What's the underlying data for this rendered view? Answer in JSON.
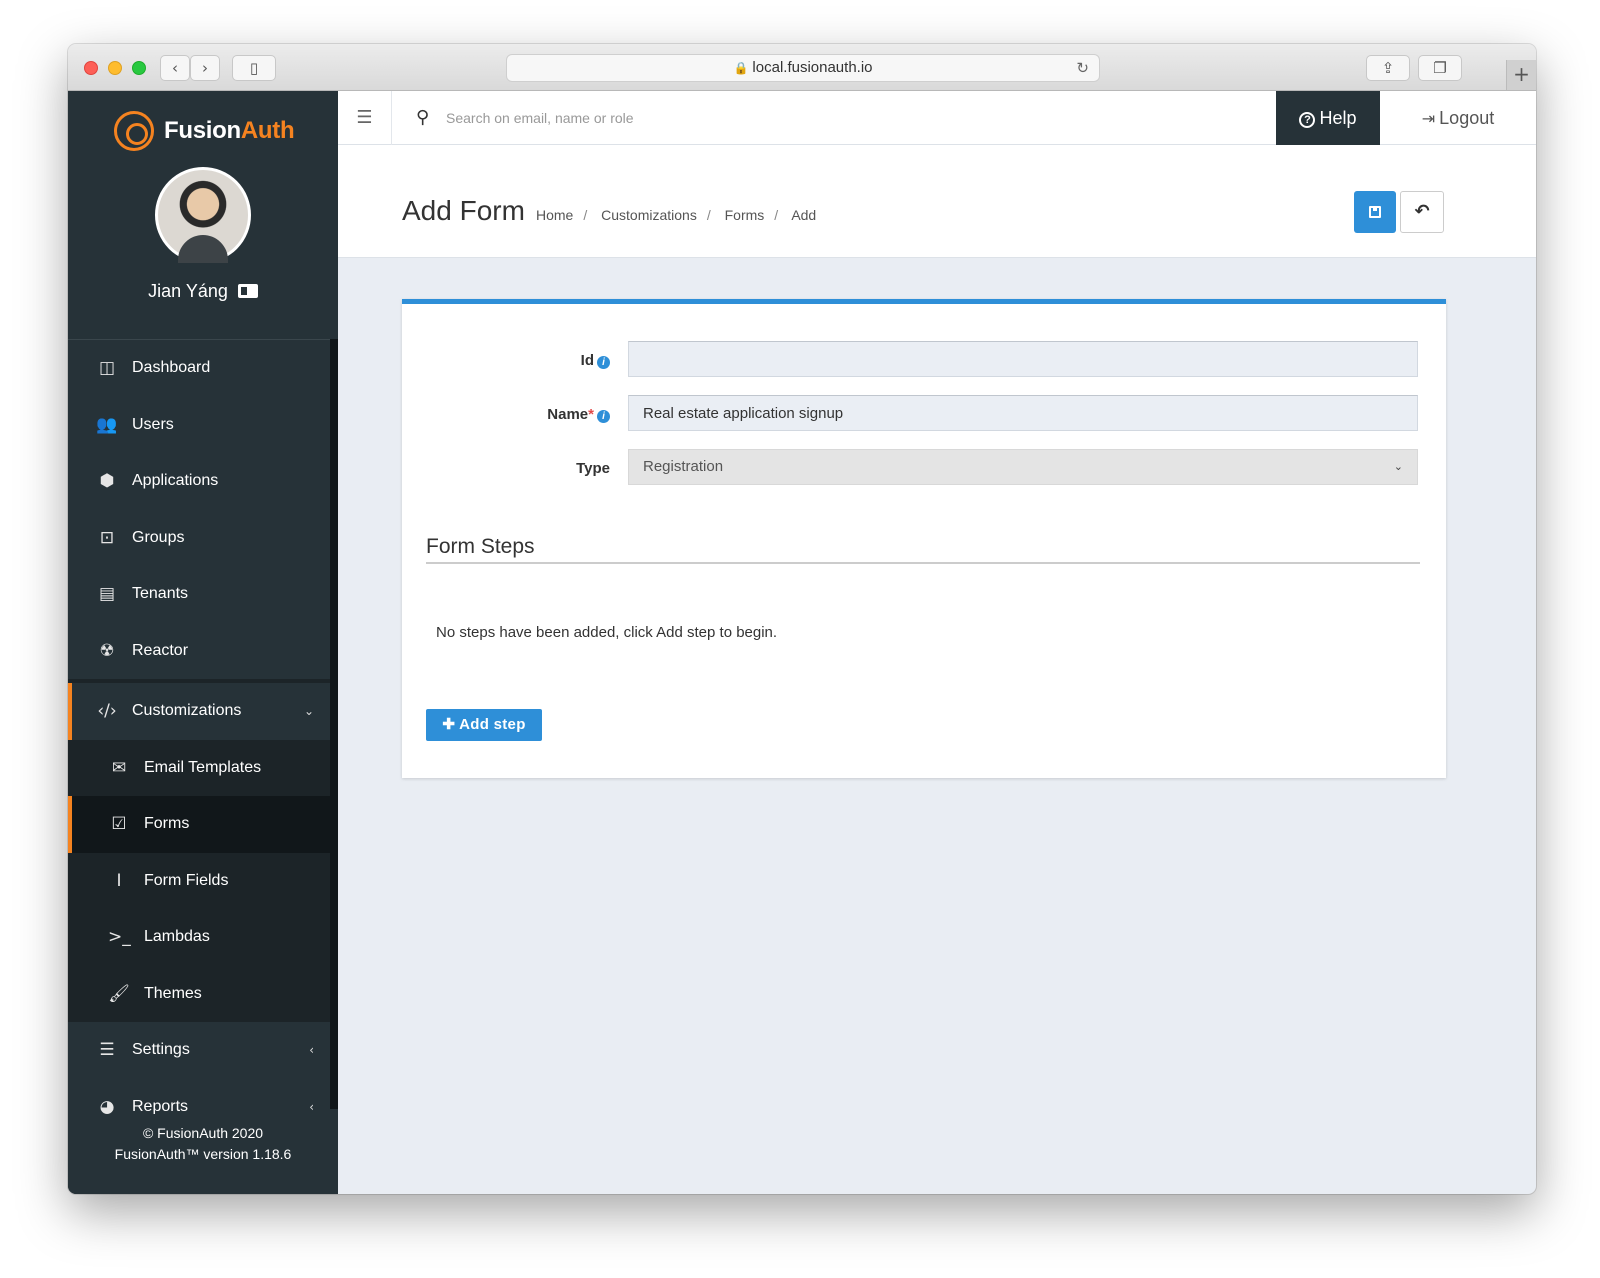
{
  "browser": {
    "url": "local.fusionauth.io"
  },
  "brand": {
    "logo_fusion": "Fusion",
    "logo_auth": "Auth",
    "accent_color": "#f58320",
    "primary_color": "#2e8fd8",
    "sidebar_color": "#263238"
  },
  "user": {
    "name": "Jian Yáng"
  },
  "sidebar": {
    "items": [
      {
        "label": "Dashboard",
        "icon": "dashboard-icon"
      },
      {
        "label": "Users",
        "icon": "users-icon"
      },
      {
        "label": "Applications",
        "icon": "cube-icon"
      },
      {
        "label": "Groups",
        "icon": "groups-icon"
      },
      {
        "label": "Tenants",
        "icon": "building-icon"
      },
      {
        "label": "Reactor",
        "icon": "reactor-icon"
      },
      {
        "label": "Customizations",
        "icon": "code-icon",
        "expanded": true
      },
      {
        "label": "Email Templates",
        "icon": "envelope-icon"
      },
      {
        "label": "Forms",
        "icon": "check-square-icon",
        "active": true
      },
      {
        "label": "Form Fields",
        "icon": "text-cursor-icon"
      },
      {
        "label": "Lambdas",
        "icon": "terminal-icon"
      },
      {
        "label": "Themes",
        "icon": "paint-brush-icon"
      },
      {
        "label": "Settings",
        "icon": "sliders-icon"
      },
      {
        "label": "Reports",
        "icon": "pie-chart-icon"
      }
    ],
    "footer_copyright": "© FusionAuth 2020",
    "footer_version": "FusionAuth™ version 1.18.6"
  },
  "topbar": {
    "search_placeholder": "Search on email, name or role",
    "help_label": "Help",
    "logout_label": "Logout"
  },
  "page": {
    "title": "Add Form",
    "breadcrumb": [
      "Home",
      "Customizations",
      "Forms",
      "Add"
    ]
  },
  "form": {
    "id_label": "Id",
    "id_value": "",
    "name_label": "Name",
    "name_required_mark": "*",
    "name_value": "Real estate application signup",
    "type_label": "Type",
    "type_value": "Registration",
    "steps_title": "Form Steps",
    "steps_empty_text": "No steps have been added, click Add step to begin.",
    "add_step_label": "Add step"
  }
}
